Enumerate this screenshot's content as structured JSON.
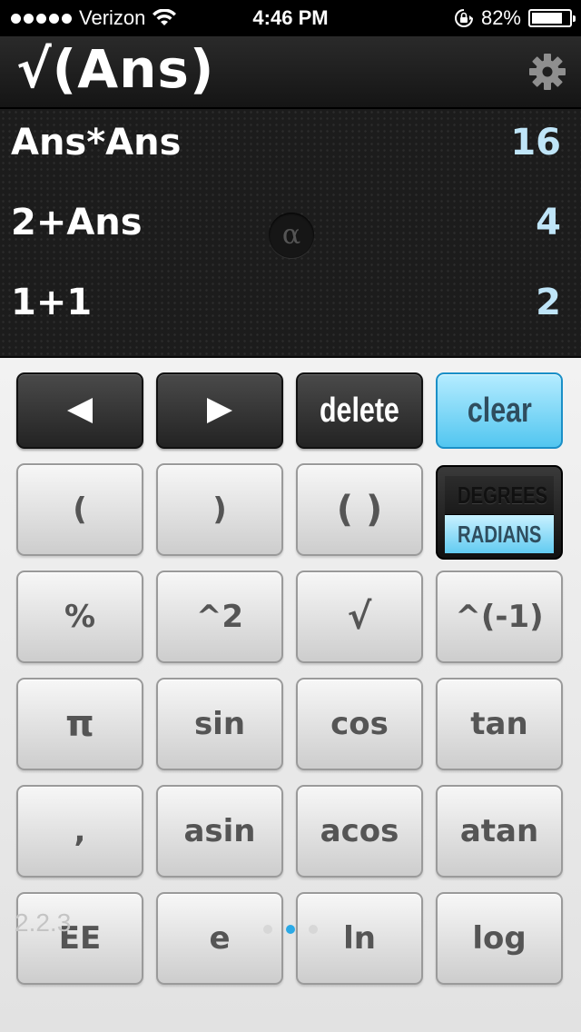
{
  "status_bar": {
    "carrier": "Verizon",
    "time": "4:46 PM",
    "battery": "82%",
    "battery_level": 0.82,
    "icons": [
      "signal-dots-icon",
      "wifi-icon",
      "rotation-lock-icon",
      "battery-icon"
    ]
  },
  "display": {
    "expression": "√(Ans)",
    "settings_icon": "gear-icon"
  },
  "history": [
    {
      "expression": "Ans*Ans",
      "result": "16"
    },
    {
      "expression": "2+Ans",
      "result": "4"
    },
    {
      "expression": "1+1",
      "result": "2"
    }
  ],
  "alpha_button": "α",
  "keys": {
    "row1": {
      "left_icon": "left-arrow-icon",
      "right_icon": "right-arrow-icon",
      "delete": "delete",
      "clear": "clear"
    },
    "row2": [
      "(",
      ")",
      "( )"
    ],
    "angle_mode": {
      "degrees": "DEGREES",
      "radians": "RADIANS",
      "selected": "RADIANS"
    },
    "row3": [
      "%",
      "^2",
      "√",
      "^(-1)"
    ],
    "row4": [
      "π",
      "sin",
      "cos",
      "tan"
    ],
    "row5": [
      ",",
      "asin",
      "acos",
      "atan"
    ],
    "row6": [
      "EE",
      "e",
      "ln",
      "log"
    ]
  },
  "version": "2.2.3",
  "page_indicator": {
    "pages": 3,
    "current": 1
  },
  "colors": {
    "accent_blue": "#52c6f0",
    "result_text": "#bfe5f8",
    "page_dot_active": "#2aa9e6",
    "page_dot_inactive": "#d7d7d7"
  }
}
